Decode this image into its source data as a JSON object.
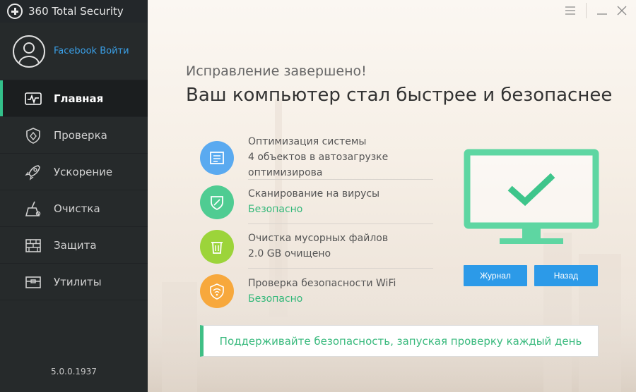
{
  "app": {
    "title": "360 Total Security",
    "version": "5.0.0.1937"
  },
  "profile": {
    "login_label": "Facebook Войти"
  },
  "sidebar": {
    "items": [
      {
        "label": "Главная",
        "icon": "pulse-monitor-icon",
        "active": true
      },
      {
        "label": "Проверка",
        "icon": "shield-scan-icon",
        "active": false
      },
      {
        "label": "Ускорение",
        "icon": "rocket-icon",
        "active": false
      },
      {
        "label": "Очистка",
        "icon": "broom-icon",
        "active": false
      },
      {
        "label": "Защита",
        "icon": "firewall-icon",
        "active": false
      },
      {
        "label": "Утилиты",
        "icon": "toolbox-icon",
        "active": false
      }
    ]
  },
  "main": {
    "subtitle": "Исправление завершено!",
    "title": "Ваш компьютер стал быстрее и безопаснее",
    "results": [
      {
        "title": "Оптимизация системы",
        "status": "4 объектов в автозагрузке оптимизирова",
        "color": "#5aaaf0",
        "icon": "list-icon",
        "safe": false
      },
      {
        "title": "Сканирование на вирусы",
        "status": "Безопасно",
        "color": "#4fcc92",
        "icon": "shield-icon",
        "safe": true
      },
      {
        "title": "Очистка мусорных файлов",
        "status": "2.0 GB очищено",
        "color": "#9cd43a",
        "icon": "trash-icon",
        "safe": false
      },
      {
        "title": "Проверка безопасности WiFi",
        "status": "Безопасно",
        "color": "#f7a83c",
        "icon": "wifi-shield-icon",
        "safe": true
      }
    ],
    "buttons": {
      "log": "Журнал",
      "back": "Назад"
    },
    "tip": "Поддерживайте безопасность, запуская проверку каждый день"
  },
  "colors": {
    "accent_green": "#3fbf85",
    "button_blue": "#2c9ae8",
    "sidebar_bg": "#262a2b"
  }
}
